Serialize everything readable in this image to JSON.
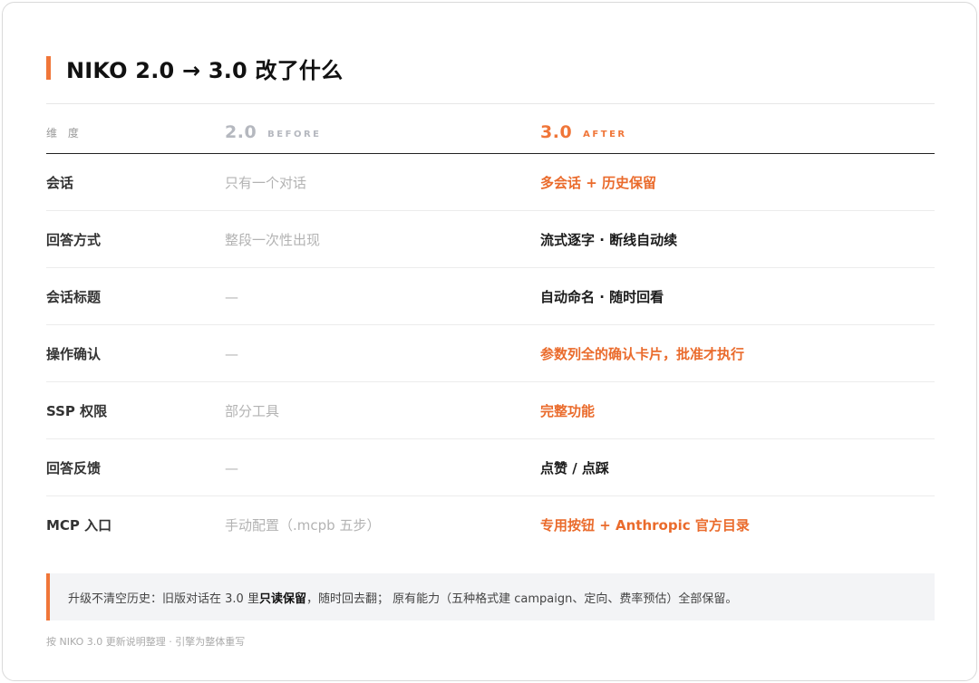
{
  "title": "NIKO 2.0 → 3.0 改了什么",
  "header": {
    "dimension": "维 度",
    "before_version": "2.0",
    "before_label": "BEFORE",
    "after_version": "3.0",
    "after_label": "AFTER"
  },
  "rows": [
    {
      "dimension": "会话",
      "before": "只有一个对话",
      "after": "多会话 + 历史保留",
      "after_color": "orange"
    },
    {
      "dimension": "回答方式",
      "before": "整段一次性出现",
      "after": "流式逐字 · 断线自动续",
      "after_color": "dark"
    },
    {
      "dimension": "会话标题",
      "before": "—",
      "after": "自动命名 · 随时回看",
      "after_color": "dark"
    },
    {
      "dimension": "操作确认",
      "before": "—",
      "after": "参数列全的确认卡片，批准才执行",
      "after_color": "orange"
    },
    {
      "dimension": "SSP 权限",
      "before": "部分工具",
      "after": "完整功能",
      "after_color": "orange"
    },
    {
      "dimension": "回答反馈",
      "before": "—",
      "after": "点赞 / 点踩",
      "after_color": "dark"
    },
    {
      "dimension": "MCP 入口",
      "before": "手动配置（.mcpb 五步）",
      "after": "专用按钮 + Anthropic 官方目录",
      "after_color": "orange"
    }
  ],
  "note": {
    "prefix": "升级不清空历史：旧版对话在 3.0 里",
    "highlight": "只读保留",
    "suffix": "，随时回去翻；  原有能力（五种格式建 campaign、定向、费率预估）全部保留。"
  },
  "footer": "按 NIKO 3.0 更新说明整理 · 引擎为整体重写",
  "colors": {
    "accent": "#f07639",
    "accent_text": "#ea6b2c",
    "muted": "#b3b3b3",
    "dark": "#1b1b1b"
  }
}
